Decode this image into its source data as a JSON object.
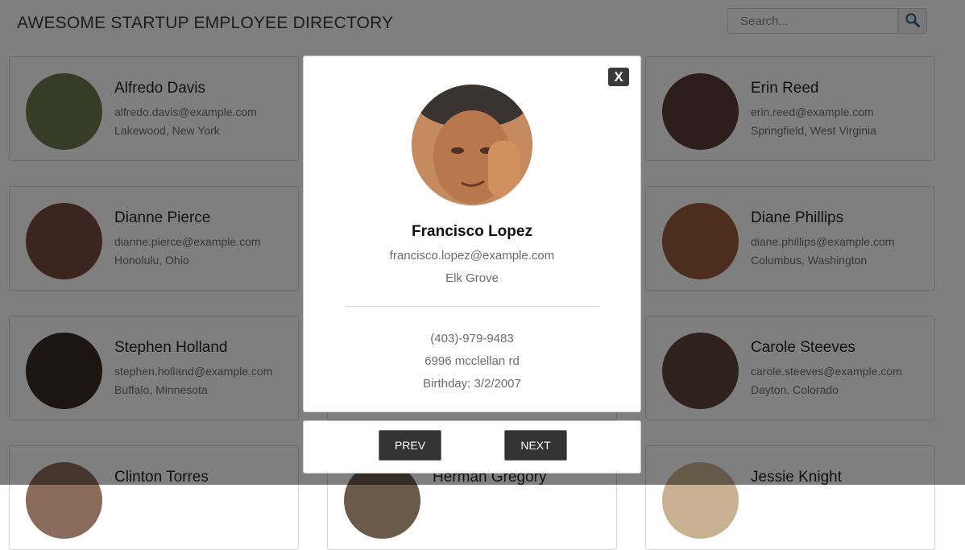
{
  "header": {
    "title": "AWESOME STARTUP EMPLOYEE DIRECTORY",
    "search_placeholder": "Search..."
  },
  "employees": [
    {
      "name": "Alfredo Davis",
      "email": "alfredo.davis@example.com",
      "location": "Lakewood, New York",
      "avatar_color": "#6b7b4f"
    },
    {
      "name": "Erin Reed",
      "email": "erin.reed@example.com",
      "location": "Springfield, West Virginia",
      "avatar_color": "#5b3a3a"
    },
    {
      "name": "Dianne Pierce",
      "email": "dianne.pierce@example.com",
      "location": "Honolulu, Ohio",
      "avatar_color": "#7a4a3e"
    },
    {
      "name": "Diane Phillips",
      "email": "diane.phillips@example.com",
      "location": "Columbus, Washington",
      "avatar_color": "#9a5a3c"
    },
    {
      "name": "Stephen Holland",
      "email": "stephen.holland@example.com",
      "location": "Buffalo, Minnesota",
      "avatar_color": "#3b2a24"
    },
    {
      "name": "Carole Steeves",
      "email": "carole.steeves@example.com",
      "location": "Dayton, Colorado",
      "avatar_color": "#5e4438"
    },
    {
      "name": "Clinton Torres",
      "avatar_color": "#8a6a5a"
    },
    {
      "name": "Herman Gregory",
      "avatar_color": "#6a5a4a"
    },
    {
      "name": "Jessie Knight",
      "avatar_color": "#c8b090"
    }
  ],
  "modal": {
    "name": "Francisco Lopez",
    "email": "francisco.lopez@example.com",
    "city": "Elk Grove",
    "phone": "(403)-979-9483",
    "address": "6996 mcclellan rd",
    "birthday": "Birthday: 3/2/2007",
    "close_label": "X",
    "avatar_color": "#7a5a44"
  },
  "nav": {
    "prev_label": "PREV",
    "next_label": "NEXT"
  }
}
